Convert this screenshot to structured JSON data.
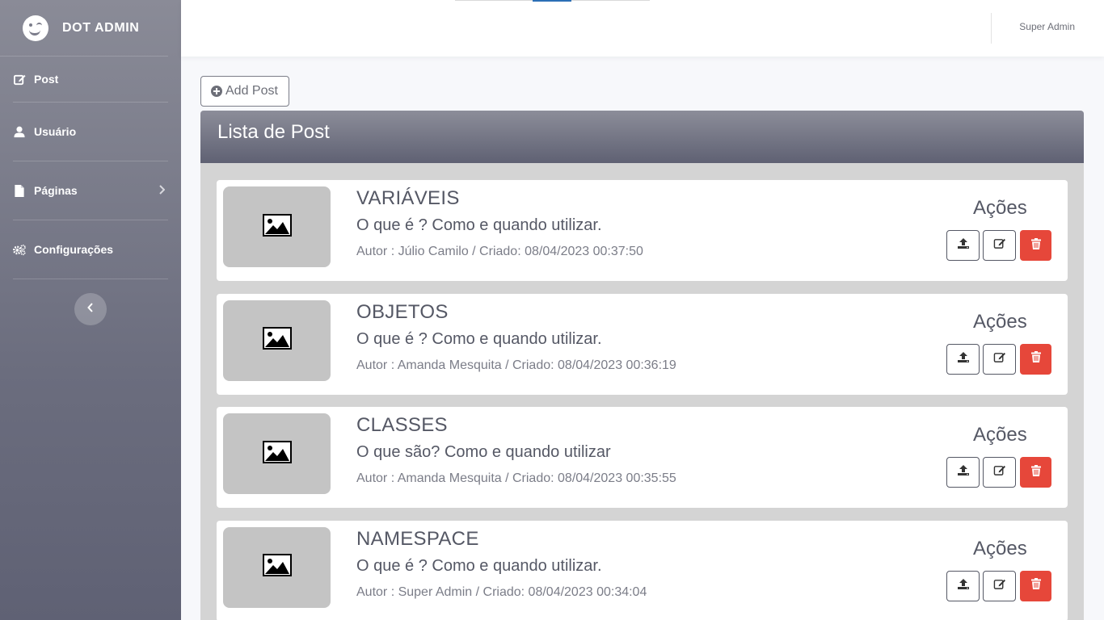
{
  "brand": {
    "name": "DOT ADMIN"
  },
  "sidebar": {
    "items": [
      {
        "label": "Post",
        "icon": "edit-icon"
      },
      {
        "label": "Usuário",
        "icon": "user-icon"
      },
      {
        "label": "Páginas",
        "icon": "file-icon",
        "has_submenu": true
      },
      {
        "label": "Configurações",
        "icon": "gears-icon"
      }
    ],
    "collapse_icon": "chevron-left-icon"
  },
  "topbar": {
    "user_name": "Super Admin"
  },
  "toolbar": {
    "add_label": "Add Post"
  },
  "card": {
    "title": "Lista de Post"
  },
  "posts": [
    {
      "title": "VARIÁVEIS",
      "description": "O que é ? Como e quando utilizar.",
      "meta": "Autor : Júlio Camilo / Criado: 08/04/2023 00:37:50",
      "actions_label": "Ações"
    },
    {
      "title": "OBJETOS",
      "description": "O que é ? Como e quando utilizar.",
      "meta": "Autor : Amanda Mesquita / Criado: 08/04/2023 00:36:19",
      "actions_label": "Ações"
    },
    {
      "title": "CLASSES",
      "description": "O que são? Como e quando utilizar",
      "meta": "Autor : Amanda Mesquita / Criado: 08/04/2023 00:35:55",
      "actions_label": "Ações"
    },
    {
      "title": "NAMESPACE",
      "description": "O que é ? Como e quando utilizar.",
      "meta": "Autor : Super Admin / Criado: 08/04/2023 00:34:04",
      "actions_label": "Ações"
    }
  ],
  "colors": {
    "sidebar": "#7b7c8a",
    "delete": "#e6473a",
    "accent": "#2c6fb6"
  }
}
